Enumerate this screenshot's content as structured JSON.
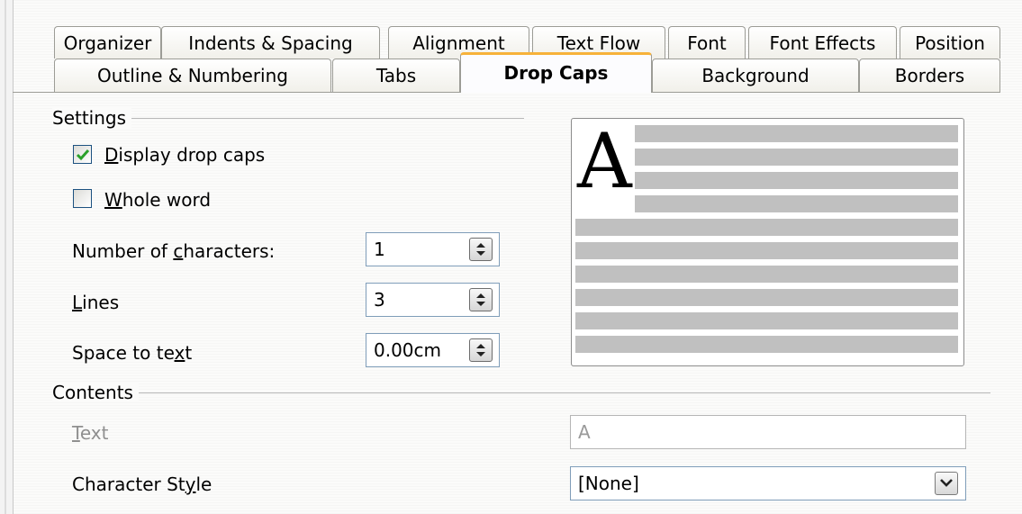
{
  "tabs_row1": [
    "Organizer",
    "Indents & Spacing",
    "Alignment",
    "Text Flow",
    "Font",
    "Font Effects",
    "Position"
  ],
  "tabs_row2": [
    "Outline & Numbering",
    "Tabs",
    "Drop Caps",
    "Background",
    "Borders"
  ],
  "active_tab": "Drop Caps",
  "settings": {
    "title": "Settings",
    "display_drop_caps": {
      "pre": "",
      "key": "D",
      "post": "isplay drop caps",
      "checked": true
    },
    "whole_word": {
      "pre": "",
      "key": "W",
      "post": "hole word",
      "checked": false
    },
    "num_chars": {
      "pre": "Number of ",
      "key": "c",
      "post": "haracters:",
      "value": "1"
    },
    "lines": {
      "pre": "",
      "key": "L",
      "post": "ines",
      "value": "3"
    },
    "space": {
      "pre": "Space to te",
      "key": "x",
      "post": "t",
      "value": "0.00cm"
    }
  },
  "contents": {
    "title": "Contents",
    "text": {
      "pre": "",
      "key": "T",
      "post": "ext",
      "value": "A"
    },
    "char_style": {
      "pre": "Character St",
      "key": "y",
      "post": "le",
      "value": "[None]"
    }
  },
  "preview": {
    "drop_letter": "A"
  },
  "colors": {
    "accent_tab": "#f7b23a",
    "check": "#2aa02a",
    "preview_line": "#c0c0c0"
  }
}
